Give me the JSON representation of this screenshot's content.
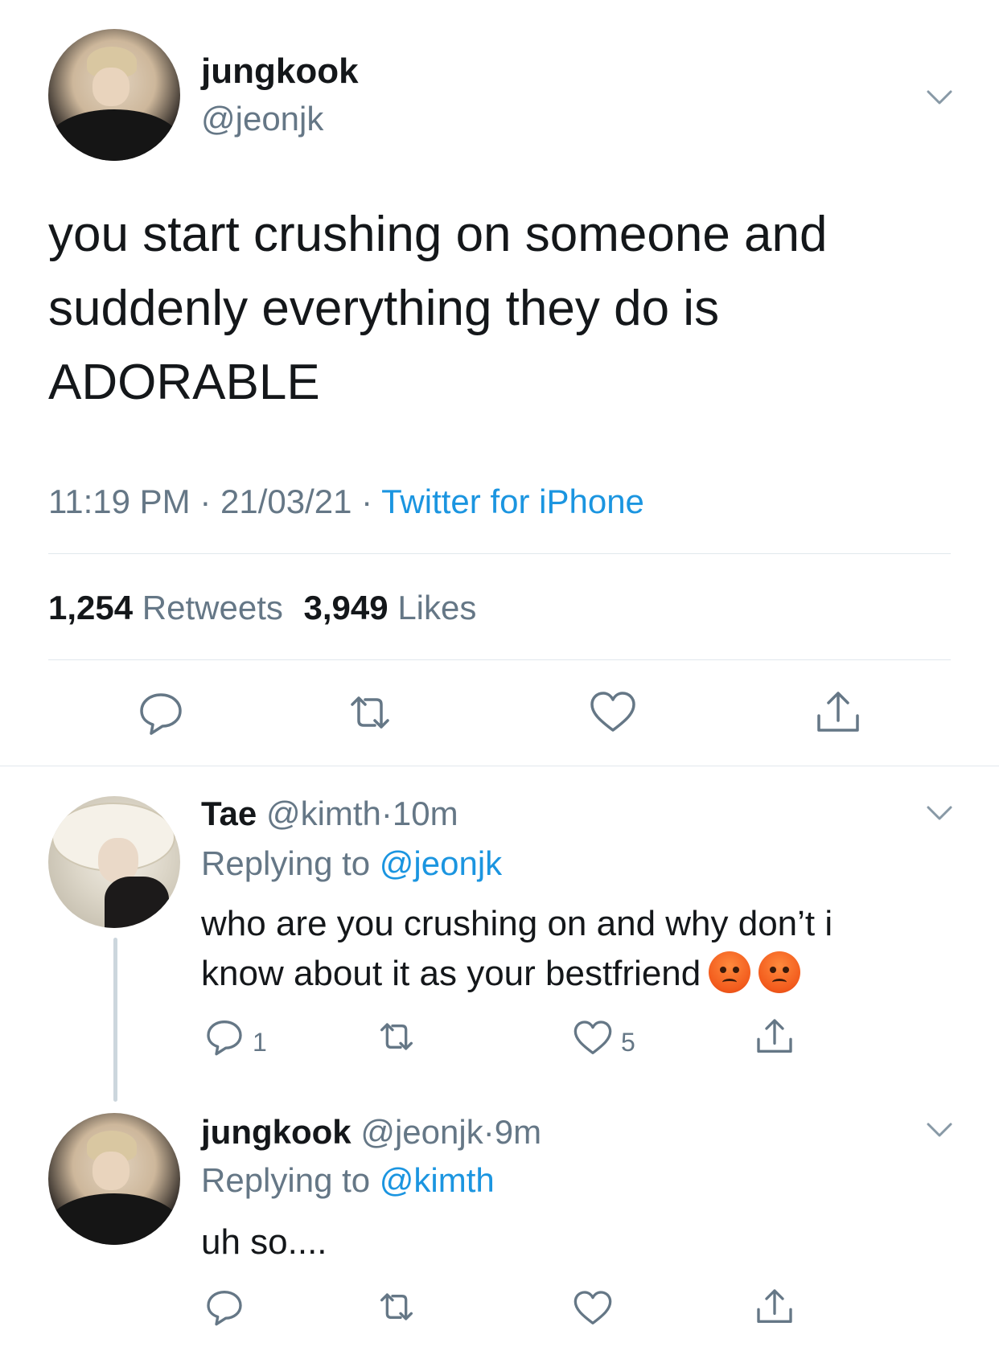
{
  "main_tweet": {
    "name": "jungkook",
    "handle": "@jeonjk",
    "text_line1": "you start crushing on someone and",
    "text_line2": "suddenly everything they do is",
    "text_line3": "ADORABLE",
    "time": "11:19 PM",
    "date": "21/03/21",
    "sep": "·",
    "source": "Twitter for iPhone",
    "retweets_count": "1,254",
    "retweets_label": "Retweets",
    "likes_count": "3,949",
    "likes_label": "Likes"
  },
  "reply1": {
    "name": "Tae",
    "handle": "@kimth",
    "sep": "·",
    "time": "10m",
    "replying_prefix": "Replying to",
    "replying_handle": "@jeonjk",
    "text_line1": "who are you crushing on and why don’t i",
    "text_line2": "know about it as your bestfriend",
    "emoji": "angry-face",
    "reply_count": "1",
    "like_count": "5"
  },
  "reply2": {
    "name": "jungkook",
    "handle": "@jeonjk",
    "sep": "·",
    "time": "9m",
    "replying_prefix": "Replying to",
    "replying_handle": "@kimth",
    "text": "uh so...."
  },
  "colors": {
    "text": "#14171a",
    "secondary": "#657786",
    "link": "#1b95e0",
    "divider": "#e1e8ed"
  }
}
